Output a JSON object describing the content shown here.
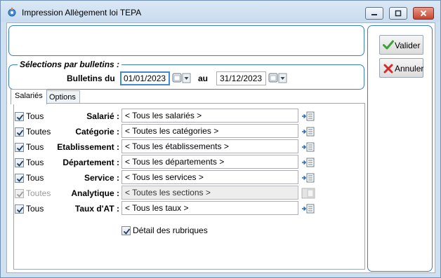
{
  "window": {
    "title": "Impression Allègement loi TEPA"
  },
  "selections": {
    "section_title": "Sélections par bulletins :",
    "bulletins_label": "Bulletins du",
    "date_from": "01/01/2023",
    "au_label": "au",
    "date_to": "31/12/2023"
  },
  "tabs": [
    {
      "label": "Salariés",
      "active": true
    },
    {
      "label": "Options",
      "active": false
    }
  ],
  "filters": [
    {
      "checkbox_label": "Tous",
      "field_label": "Salarié :",
      "value": "< Tous les salariés >",
      "checked": true,
      "enabled": true
    },
    {
      "checkbox_label": "Toutes",
      "field_label": "Catégorie :",
      "value": "< Toutes les catégories >",
      "checked": true,
      "enabled": true
    },
    {
      "checkbox_label": "Tous",
      "field_label": "Etablissement :",
      "value": "< Tous les établissements >",
      "checked": true,
      "enabled": true
    },
    {
      "checkbox_label": "Tous",
      "field_label": "Département :",
      "value": "< Tous les départements >",
      "checked": true,
      "enabled": true
    },
    {
      "checkbox_label": "Tous",
      "field_label": "Service :",
      "value": "< Tous les services >",
      "checked": true,
      "enabled": true
    },
    {
      "checkbox_label": "Toutes",
      "field_label": "Analytique :",
      "value": "< Toutes les sections >",
      "checked": true,
      "enabled": false
    },
    {
      "checkbox_label": "Tous",
      "field_label": "Taux d'AT :",
      "value": "< Tous les taux >",
      "checked": true,
      "enabled": true
    }
  ],
  "detail": {
    "label": "Détail des rubriques",
    "checked": true
  },
  "buttons": {
    "validate_label": "Valider",
    "cancel_label": "Annuler"
  },
  "colors": {
    "panel_border": "#3a7fc0",
    "check_green": "#3aa335",
    "cancel_red": "#d32a2a",
    "focus_blue": "#3f8ad6"
  },
  "icons": {
    "validate": "check-icon",
    "cancel": "cross-icon",
    "picker": "list-picker-icon",
    "calendar": "calendar-icon"
  }
}
